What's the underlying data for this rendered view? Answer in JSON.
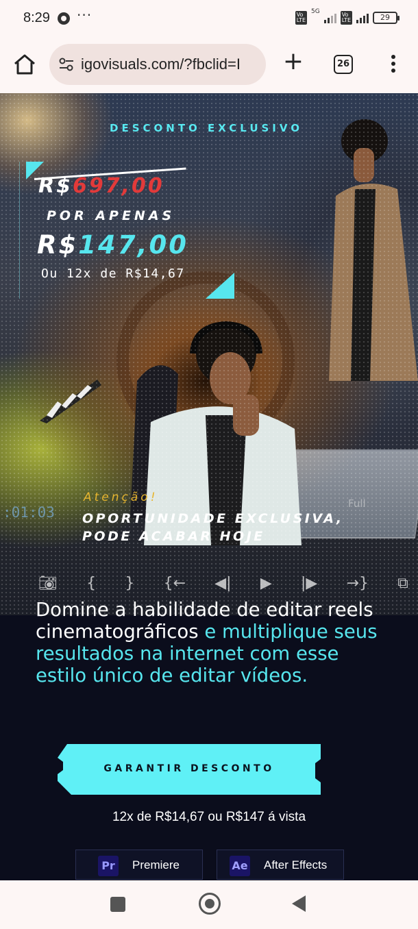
{
  "status_bar": {
    "time": "8:29",
    "network": "5G",
    "battery": "29"
  },
  "browser": {
    "url": "igovisuals.com/?fbclid=I",
    "tab_count": "26"
  },
  "hero": {
    "exclusive_label": "DESCONTO EXCLUSIVO",
    "old_price_currency": "R$",
    "old_price_value": "697,00",
    "por_apenas": "POR APENAS",
    "new_price_currency": "R$",
    "new_price_value": "147,00",
    "installments": "Ou 12x de R$14,67",
    "attention": "Atenção!",
    "opportunity_line1": "OPORTUNIDADE EXCLUSIVA,",
    "opportunity_line2": "PODE ACABAR HOJE",
    "timecode": ":01:03",
    "full_label": "Full"
  },
  "content": {
    "headline_white_1": "Domine a habilidade de editar reels cinematográficos",
    "headline_cyan_1": " e multiplique seus resultados na internet com esse estilo único de editar vídeos.",
    "cta_label": "GARANTIR DESCONTO",
    "cta_note": "12x de R$14,67 ou R$147 á vista",
    "apps": [
      {
        "badge": "Pr",
        "name": "Premiere"
      },
      {
        "badge": "Ae",
        "name": "After Effects"
      }
    ]
  },
  "colors": {
    "accent_cyan": "#57e6ee",
    "old_price_red": "#e23a3a",
    "attention_gold": "#e7b52e",
    "dark_bg": "#0b0d1c"
  }
}
